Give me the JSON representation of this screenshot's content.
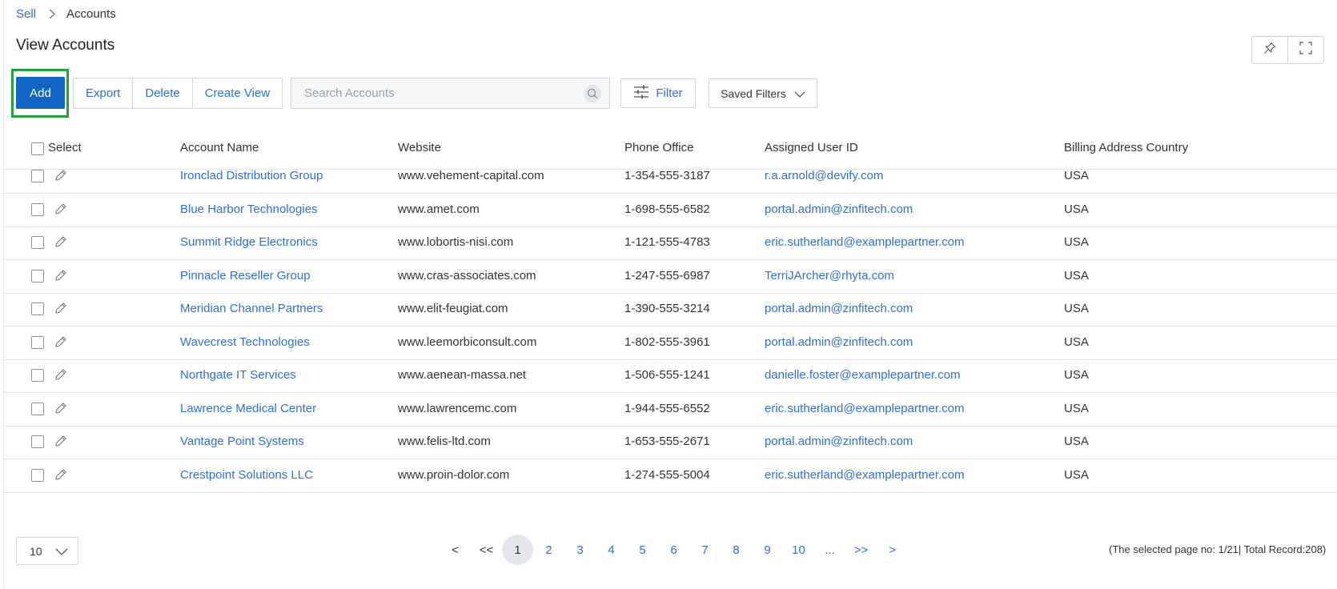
{
  "breadcrumb": {
    "parent": "Sell",
    "current": "Accounts"
  },
  "page_title": "View Accounts",
  "toolbar": {
    "add_label": "Add",
    "export_label": "Export",
    "delete_label": "Delete",
    "create_view_label": "Create View",
    "search_placeholder": "Search Accounts",
    "filter_label": "Filter",
    "saved_filters_label": "Saved Filters"
  },
  "table": {
    "columns": [
      "Select",
      "Account Name",
      "Website",
      "Phone Office",
      "Assigned User ID",
      "Billing Address Country"
    ],
    "rows": [
      {
        "name": "Ironclad Distribution Group",
        "website": "www.vehement-capital.com",
        "phone": "1-354-555-3187",
        "user": "r.a.arnold@devify.com",
        "country": "USA"
      },
      {
        "name": "Blue Harbor Technologies",
        "website": "www.amet.com",
        "phone": "1-698-555-6582",
        "user": "portal.admin@zinfitech.com",
        "country": "USA"
      },
      {
        "name": "Summit Ridge Electronics",
        "website": "www.lobortis-nisi.com",
        "phone": "1-121-555-4783",
        "user": "eric.sutherland@examplepartner.com",
        "country": "USA"
      },
      {
        "name": "Pinnacle Reseller Group",
        "website": "www.cras-associates.com",
        "phone": "1-247-555-6987",
        "user": "TerriJArcher@rhyta.com",
        "country": "USA"
      },
      {
        "name": "Meridian Channel Partners",
        "website": "www.elit-feugiat.com",
        "phone": "1-390-555-3214",
        "user": "portal.admin@zinfitech.com",
        "country": "USA"
      },
      {
        "name": "Wavecrest Technologies",
        "website": "www.leemorbiconsult.com",
        "phone": "1-802-555-3961",
        "user": "portal.admin@zinfitech.com",
        "country": "USA"
      },
      {
        "name": "Northgate IT Services",
        "website": "www.aenean-massa.net",
        "phone": "1-506-555-1241",
        "user": "danielle.foster@examplepartner.com",
        "country": "USA"
      },
      {
        "name": "Lawrence Medical Center",
        "website": "www.lawrencemc.com",
        "phone": "1-944-555-6552",
        "user": "eric.sutherland@examplepartner.com",
        "country": "USA"
      },
      {
        "name": "Vantage Point Systems",
        "website": "www.felis-ltd.com",
        "phone": "1-653-555-2671",
        "user": "portal.admin@zinfitech.com",
        "country": "USA"
      },
      {
        "name": "Crestpoint Solutions LLC",
        "website": "www.proin-dolor.com",
        "phone": "1-274-555-5004",
        "user": "eric.sutherland@examplepartner.com",
        "country": "USA"
      }
    ]
  },
  "pagination": {
    "page_size": "10",
    "prev": "<",
    "first": "<<",
    "pages": [
      "1",
      "2",
      "3",
      "4",
      "5",
      "6",
      "7",
      "8",
      "9",
      "10"
    ],
    "active_page": "1",
    "ellipsis": "...",
    "last": ">>",
    "next": ">",
    "info": "(The selected page no: 1/21| Total Record:208)"
  },
  "colors": {
    "primary": "#1265c4",
    "link": "#2f6fd6",
    "highlight": "#1fa23a"
  },
  "icons": {
    "breadcrumb_sep": "chevron-right-icon",
    "pin": "pin-icon",
    "expand": "expand-icon",
    "search": "search-icon",
    "filter": "sliders-icon",
    "dropdown": "chevron-down-icon",
    "edit": "pencil-icon"
  }
}
